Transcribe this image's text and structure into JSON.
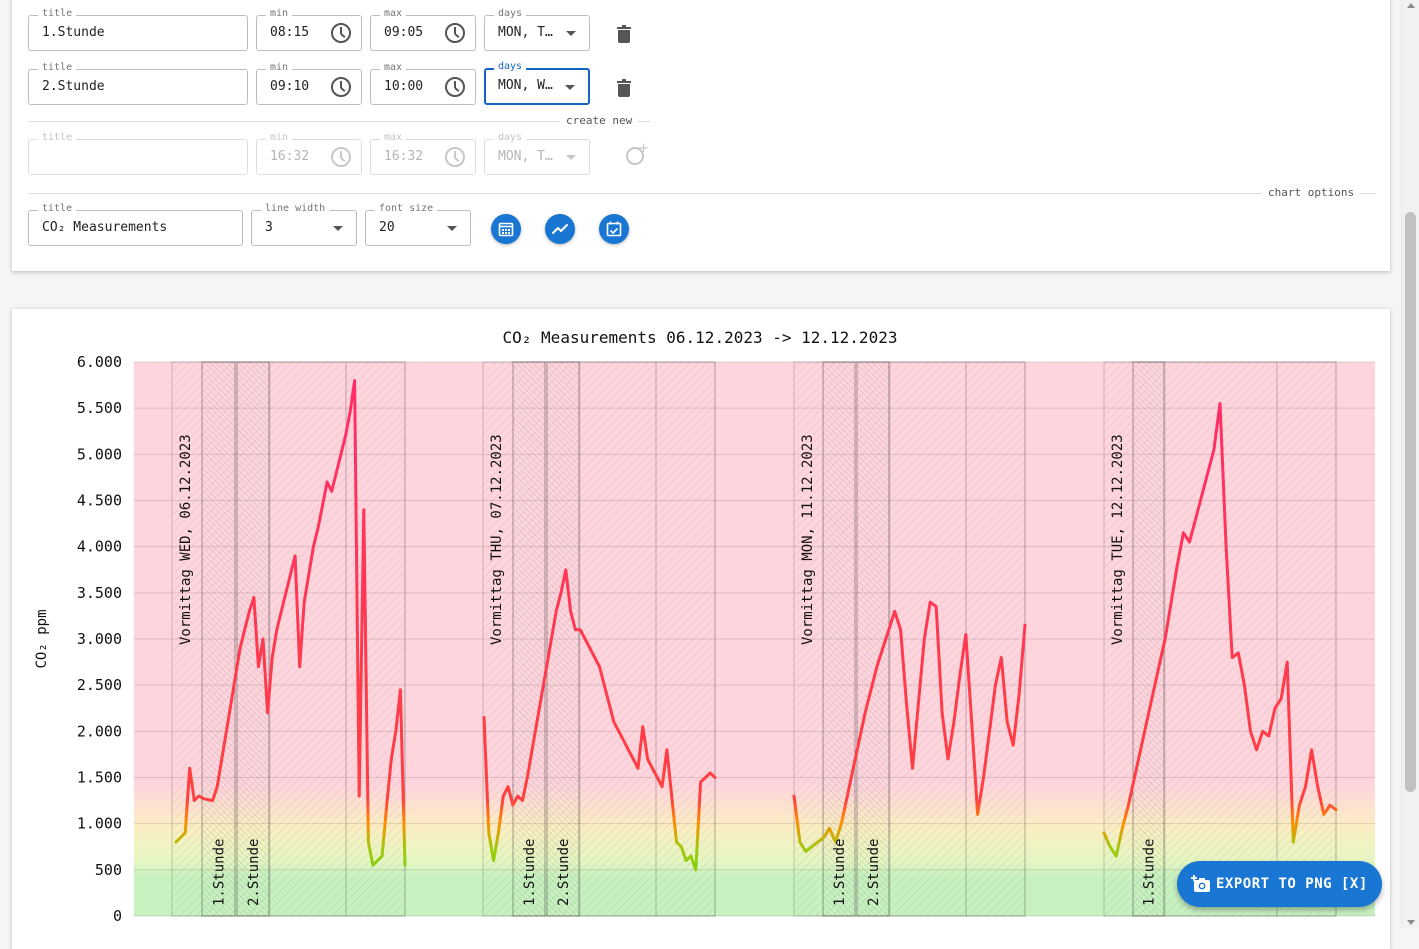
{
  "rows": [
    {
      "title_label": "title",
      "title": "1.Stunde",
      "min_label": "min",
      "min": "08:15",
      "max_label": "max",
      "max": "09:05",
      "days_label": "days",
      "days": "MON, T…"
    },
    {
      "title_label": "title",
      "title": "2.Stunde",
      "min_label": "min",
      "min": "09:10",
      "max_label": "max",
      "max": "10:00",
      "days_label": "days",
      "days": "MON, W…"
    }
  ],
  "create_new": {
    "divider_label": "create new",
    "title_label": "title",
    "title": "",
    "min_label": "min",
    "min": "16:32",
    "max_label": "max",
    "max": "16:32",
    "days_label": "days",
    "days": "MON, T…"
  },
  "chart_options": {
    "divider_label": "chart options",
    "title_label": "title",
    "title": "CO₂ Measurements",
    "line_width_label": "line width",
    "line_width": "3",
    "font_size_label": "font size",
    "font_size": "20",
    "buttons": [
      "calendar-grid-icon",
      "trend-line-icon",
      "calendar-check-icon"
    ]
  },
  "export_button": {
    "label": "EXPORT TO PNG [X]",
    "icon": "add-photo-icon"
  },
  "colors": {
    "accent": "#1976d2",
    "line": "#ff2d6b",
    "high_zone": "#ffd3dc",
    "ok_zone": "#c8f1c0"
  },
  "chart_data": {
    "type": "line",
    "title": "CO₂ Measurements 06.12.2023 -> 12.12.2023",
    "ylabel": "CO₂ ppm",
    "xlabel": "",
    "ylim": [
      0,
      6000
    ],
    "yticks": [
      "0",
      "500",
      "1.000",
      "1.500",
      "2.000",
      "2.500",
      "3.000",
      "3.500",
      "4.000",
      "4.500",
      "5.000",
      "5.500",
      "6.000"
    ],
    "grid": true,
    "days": [
      {
        "label": "Vormittag WED, 06.12.2023",
        "lessons": [
          "1.Stunde",
          "2.Stunde"
        ],
        "values": [
          800,
          850,
          900,
          1600,
          1250,
          1300,
          1270,
          1260,
          1250,
          1400,
          1700,
          2000,
          2300,
          2600,
          2900,
          3100,
          3300,
          3450,
          2700,
          3000,
          2200,
          2800,
          3100,
          3300,
          3500,
          3700,
          3900,
          2700,
          3400,
          3700,
          4000,
          4200,
          4450,
          4700,
          4600,
          4800,
          5000,
          5200,
          5450,
          5800,
          1300,
          4400,
          800,
          550,
          600,
          650,
          1200,
          1700,
          2000,
          2450,
          550
        ]
      },
      {
        "label": "Vormittag THU, 07.12.2023",
        "lessons": [
          "1.Stunde",
          "2.Stunde"
        ],
        "values": [
          2150,
          900,
          600,
          900,
          1300,
          1400,
          1200,
          1300,
          1250,
          1500,
          1800,
          2100,
          2400,
          2700,
          3000,
          3300,
          3500,
          3750,
          3300,
          3100,
          3100,
          3000,
          2900,
          2800,
          2700,
          2500,
          2300,
          2100,
          2000,
          1900,
          1800,
          1700,
          1600,
          2050,
          1700,
          1600,
          1500,
          1400,
          1800,
          1300,
          800,
          750,
          600,
          650,
          500,
          1450,
          1500,
          1550,
          1500
        ]
      },
      {
        "label": "Vormittag MON, 11.12.2023",
        "lessons": [
          "1.Stunde",
          "2.Stunde"
        ],
        "values": [
          1300,
          800,
          700,
          750,
          800,
          850,
          950,
          800,
          1000,
          1300,
          1600,
          1900,
          2200,
          2450,
          2700,
          2900,
          3100,
          3300,
          3100,
          2300,
          1600,
          2300,
          3000,
          3400,
          3350,
          2200,
          1700,
          2100,
          2600,
          3050,
          2100,
          1100,
          1500,
          2000,
          2500,
          2800,
          2100,
          1850,
          2400,
          3150
        ]
      },
      {
        "label": "Vormittag TUE, 12.12.2023",
        "lessons": [
          "1.Stunde"
        ],
        "values": [
          900,
          750,
          650,
          950,
          1200,
          1500,
          1800,
          2100,
          2400,
          2700,
          3000,
          3400,
          3800,
          4150,
          4050,
          4300,
          4550,
          4800,
          5050,
          5550,
          4000,
          2800,
          2850,
          2500,
          2000,
          1800,
          2000,
          1950,
          2250,
          2350,
          2750,
          800,
          1200,
          1400,
          1800,
          1400,
          1100,
          1200,
          1150
        ]
      }
    ]
  }
}
